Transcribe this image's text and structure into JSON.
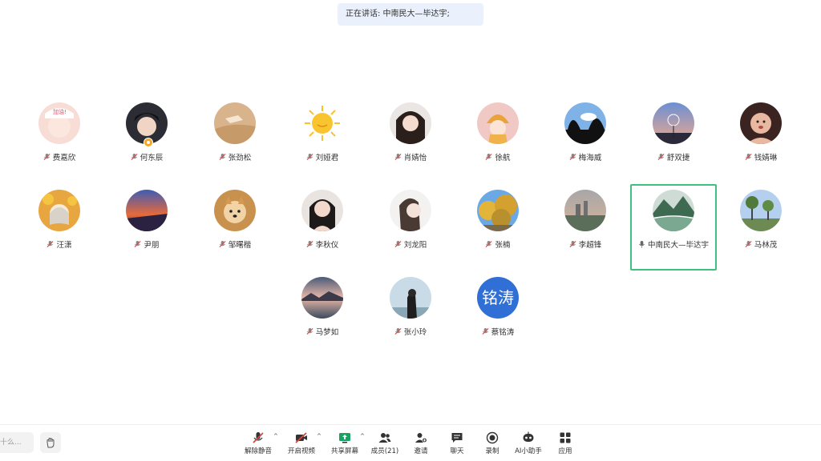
{
  "speaking_banner": "正在讲话: 中南民大—毕达宇;",
  "participants": [
    {
      "name": "费嘉欣"
    },
    {
      "name": "何东辰"
    },
    {
      "name": "张劲松"
    },
    {
      "name": "刘娅君"
    },
    {
      "name": "肖婧怡"
    },
    {
      "name": "徐航"
    },
    {
      "name": "梅海威"
    },
    {
      "name": "舒双捷"
    },
    {
      "name": "钱婧琳"
    },
    {
      "name": "汪潇"
    },
    {
      "name": "尹朋"
    },
    {
      "name": "邹曙楷"
    },
    {
      "name": "李秋仪"
    },
    {
      "name": "刘龙阳"
    },
    {
      "name": "张楠"
    },
    {
      "name": "李超锋"
    },
    {
      "name": "中南民大—毕达宇"
    },
    {
      "name": "马林茂"
    },
    {
      "name": "马梦如"
    },
    {
      "name": "张小玲"
    },
    {
      "name": "蔡铭涛",
      "avatar_text": "铭涛"
    }
  ],
  "chat_placeholder": "十么...",
  "toolbar": {
    "unmute": "解除静音",
    "video": "开启视频",
    "share": "共享屏幕",
    "members": "成员(21)",
    "invite": "邀请",
    "chat": "聊天",
    "record": "录制",
    "ai": "AI小助手",
    "apps": "应用"
  },
  "colors": {
    "active_border": "#3fc07f",
    "banner_bg": "#eaf1fd",
    "text_avatar_bg": "#2f6fd6",
    "host_badge": "#f5a623",
    "muted_icon": "#d9534f"
  }
}
